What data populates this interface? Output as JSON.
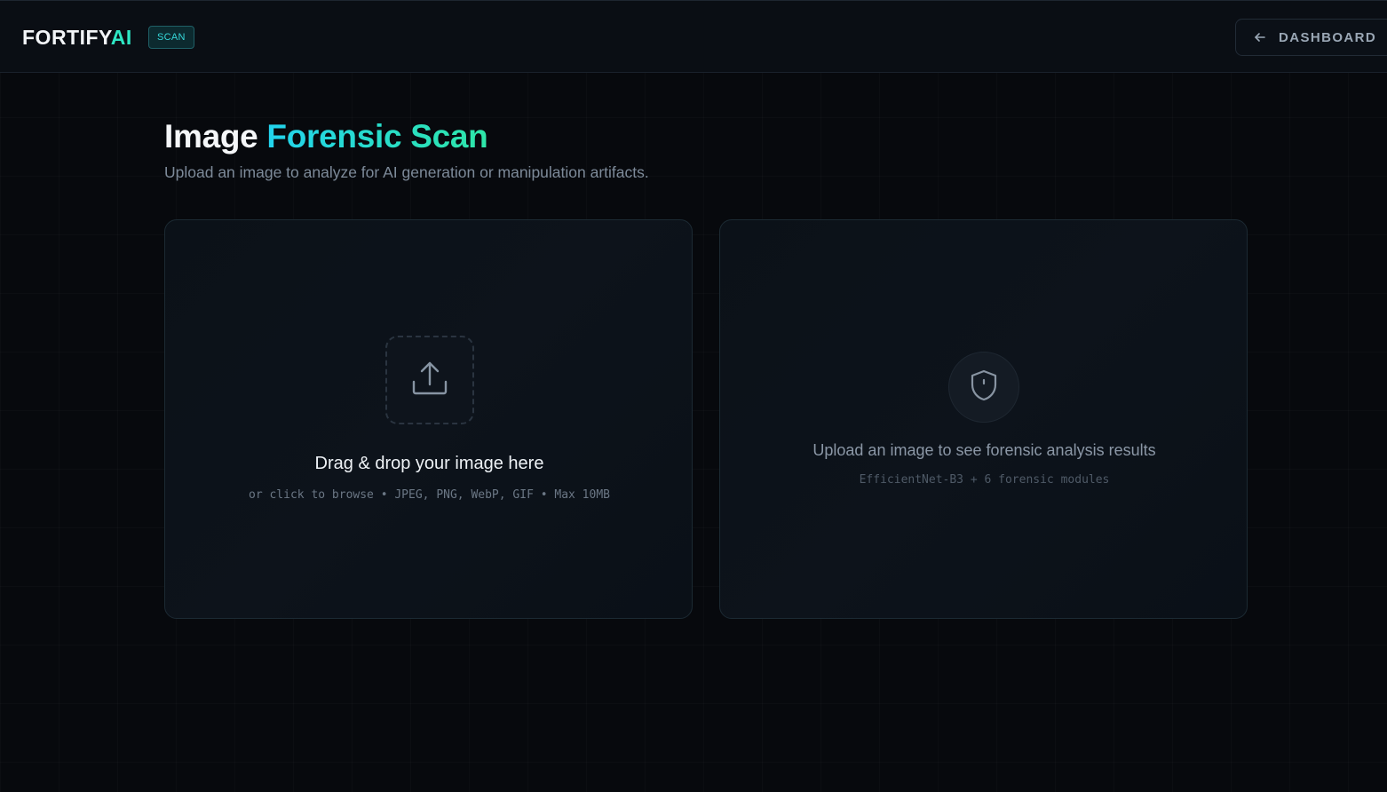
{
  "header": {
    "brand_main": "FORTIFY",
    "brand_accent": "AI",
    "badge": "SCAN",
    "dashboard_button": "DASHBOARD",
    "dashboard_icon": "arrow-left-icon"
  },
  "page": {
    "title_plain": "Image ",
    "title_accent": "Forensic Scan",
    "subtitle": "Upload an image to analyze for AI generation or manipulation artifacts."
  },
  "upload_panel": {
    "icon": "upload-icon",
    "title": "Drag & drop your image here",
    "hint": "or click to browse • JPEG, PNG, WebP, GIF • Max 10MB"
  },
  "results_panel": {
    "icon": "shield-icon",
    "title": "Upload an image to see forensic analysis results",
    "model_info": "EfficientNet-B3 + 6 forensic modules"
  },
  "colors": {
    "accent_teal": "#2ee6c4",
    "accent_cyan": "#22d3ee",
    "background": "#07090d"
  }
}
